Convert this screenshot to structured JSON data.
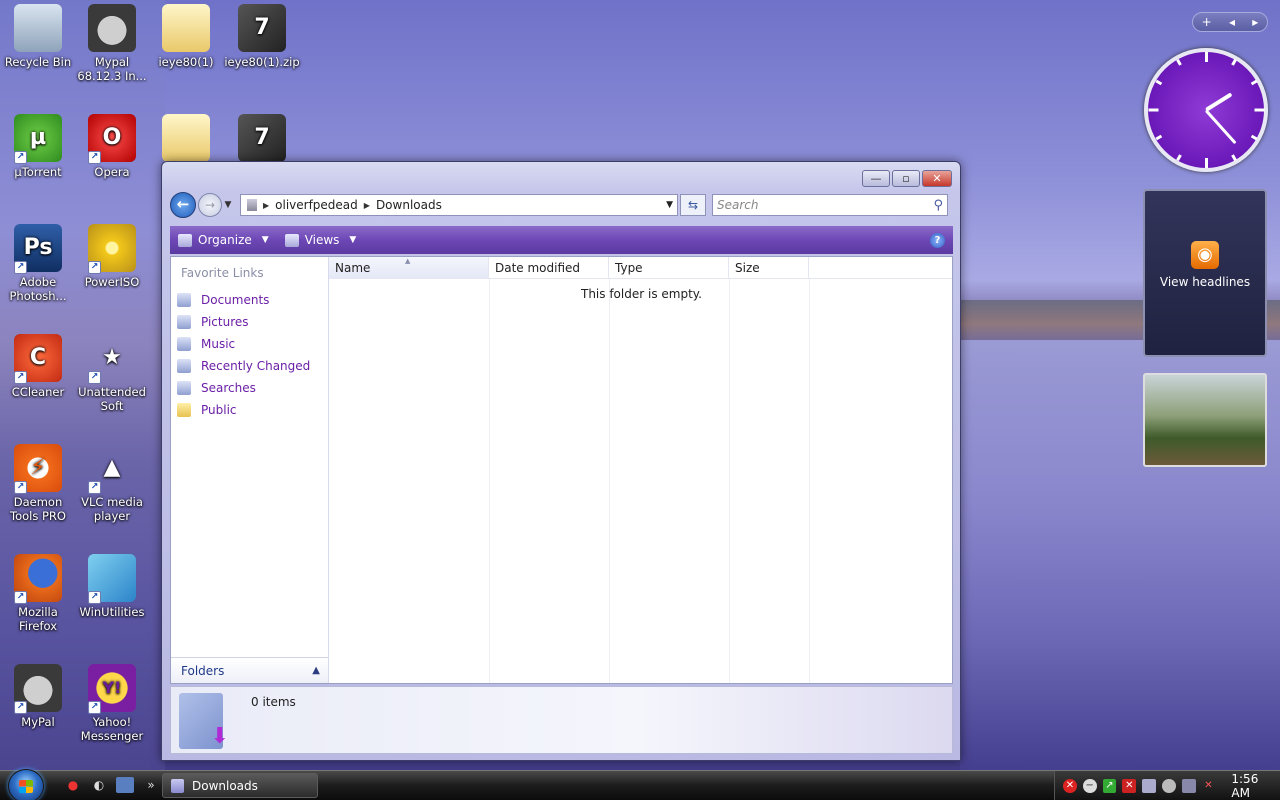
{
  "desktop": {
    "icons": [
      {
        "label": "Recycle Bin",
        "glyph": ""
      },
      {
        "label": "Mypal 68.12.3 In...",
        "glyph": ""
      },
      {
        "label": "ieye80(1)",
        "glyph": ""
      },
      {
        "label": "ieye80(1).zip",
        "glyph": "7"
      },
      {
        "label": "µTorrent",
        "glyph": "µ"
      },
      {
        "label": "Opera",
        "glyph": "O"
      },
      {
        "label": "",
        "glyph": ""
      },
      {
        "label": "",
        "glyph": "7"
      },
      {
        "label": "Adobe Photosh...",
        "glyph": "Ps"
      },
      {
        "label": "PowerISO",
        "glyph": ""
      },
      {
        "label": "CCleaner",
        "glyph": "C"
      },
      {
        "label": "Unattended Soft",
        "glyph": "★"
      },
      {
        "label": "Daemon Tools PRO",
        "glyph": "⚡"
      },
      {
        "label": "VLC media player",
        "glyph": "▲"
      },
      {
        "label": "Mozilla Firefox",
        "glyph": ""
      },
      {
        "label": "WinUtilities",
        "glyph": ""
      },
      {
        "label": "MyPal",
        "glyph": ""
      },
      {
        "label": "Yahoo! Messenger",
        "glyph": "Y!"
      }
    ]
  },
  "gadgets": {
    "toolbar": {
      "add": "+",
      "prev": "◂",
      "next": "▸"
    },
    "feed": {
      "label": "View headlines",
      "icon": "rss-icon"
    },
    "clock_time": "1:56"
  },
  "window": {
    "controls": {
      "minimize": "—",
      "maximize": "▫",
      "close": "✕"
    },
    "address": {
      "root": "oliverfpedead",
      "current": "Downloads"
    },
    "search": {
      "placeholder": "Search"
    },
    "toolbar": {
      "organize": "Organize",
      "views": "Views",
      "help": "?"
    },
    "nav": {
      "title": "Favorite Links",
      "items": [
        {
          "label": "Documents",
          "icon": "documents-icon"
        },
        {
          "label": "Pictures",
          "icon": "pictures-icon"
        },
        {
          "label": "Music",
          "icon": "music-icon"
        },
        {
          "label": "Recently Changed",
          "icon": "recently-changed-icon"
        },
        {
          "label": "Searches",
          "icon": "searches-icon"
        },
        {
          "label": "Public",
          "icon": "folder-icon"
        }
      ],
      "folders_label": "Folders"
    },
    "columns": {
      "name": "Name",
      "date": "Date modified",
      "type": "Type",
      "size": "Size"
    },
    "empty_message": "This folder is empty.",
    "details": {
      "count": "0 items"
    }
  },
  "taskbar": {
    "task": "Downloads",
    "quicklaunch_more": "»",
    "time": "1:56 AM"
  },
  "colors": {
    "accent": "#6d47b5",
    "link": "#6b1fa6"
  }
}
